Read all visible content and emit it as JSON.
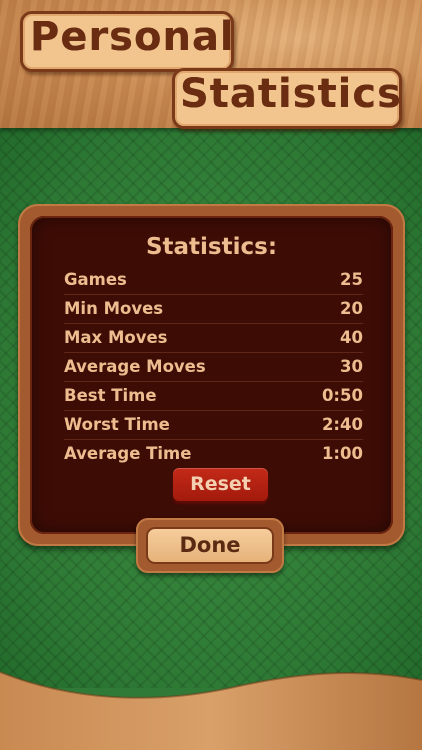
{
  "header": {
    "title_line1": "Personal",
    "title_line2": "Statistics"
  },
  "panel": {
    "title": "Statistics:",
    "rows": [
      {
        "label": "Games",
        "value": "25"
      },
      {
        "label": "Min Moves",
        "value": "20"
      },
      {
        "label": "Max Moves",
        "value": "40"
      },
      {
        "label": "Average Moves",
        "value": "30"
      },
      {
        "label": "Best Time",
        "value": "0:50"
      },
      {
        "label": "Worst Time",
        "value": "2:40"
      },
      {
        "label": "Average Time",
        "value": "1:00"
      }
    ],
    "reset_label": "Reset"
  },
  "footer": {
    "done_label": "Done"
  },
  "colors": {
    "felt": "#2f7a36",
    "wood": "#c98a52",
    "panel_bg": "#3d0c05",
    "text": "#eebd8f",
    "reset": "#c42a18"
  }
}
